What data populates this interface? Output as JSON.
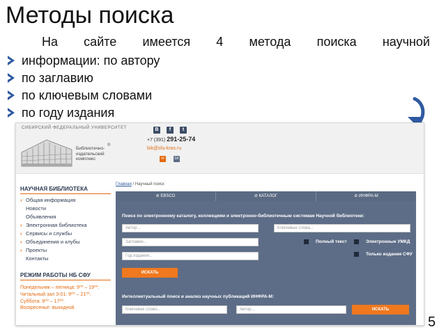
{
  "slide": {
    "title": "Методы поиска",
    "intro": "На сайте имеется 4 метода поиска научной",
    "bullets": [
      "информации: по автору",
      "по заглавию",
      "по ключевым словами",
      "по году издания"
    ],
    "page_number": "5",
    "accent_color": "#2f5aa0"
  },
  "site": {
    "university": "СИБИРСКИЙ ФЕДЕРАЛЬНЫЙ УНИВЕРСИТЕТ",
    "publisher": [
      "Библиотечно-",
      "издательский",
      "комплекс"
    ],
    "registered": "®",
    "social": [
      "В",
      "f",
      "t"
    ],
    "phone_prefix": "+7 (391)",
    "phone_number": "291-25-74",
    "email": "bik@sfu-kras.ru",
    "mini_icons": [
      "✉",
      "SK"
    ],
    "breadcrumb_home": "Главная",
    "breadcrumb_sep": "/",
    "breadcrumb_current": "Научный поиск",
    "tabs": [
      "⊘ EBSCO",
      "⊘ КАТАЛОГ",
      "⊘ ИНФРА-М"
    ],
    "sidebar": {
      "section1": "НАУЧНАЯ БИБЛИОТЕКА",
      "items": [
        {
          "arrow": "›",
          "label": "Общая информация"
        },
        {
          "arrow": "",
          "label": "Новости"
        },
        {
          "arrow": "",
          "label": "Объявления"
        },
        {
          "arrow": "›",
          "label": "Электронная библиотека"
        },
        {
          "arrow": "›",
          "label": "Сервисы и службы"
        },
        {
          "arrow": "›",
          "label": "Объединения и клубы"
        },
        {
          "arrow": "›",
          "label": "Проекты"
        },
        {
          "arrow": "",
          "label": "Контакты"
        }
      ],
      "section2": "РЕЖИМ РАБОТЫ НБ СФУ",
      "hours": [
        "Понедельник – пятница: 9⁰⁰ – 19⁰⁰.",
        "Читальный зал 3-01: 9⁰⁰ – 21⁰⁰.",
        "Суббота: 9⁰⁰ – 17⁰⁰.",
        "Воскресенье: выходной."
      ]
    },
    "search": {
      "title": "Поиск по электронному каталогу, коллекциям и электронно-библиотечным системам Научной библиотеки:",
      "author_placeholder": "Автор...",
      "keywords_placeholder": "Ключевые слова...",
      "title_placeholder": "Заглавие...",
      "year_placeholder": "Год издания...",
      "checkbox_fulltext": "Полный текст",
      "checkbox_umkd": "Электронные УМКД",
      "checkbox_sfu": "Только издания СФУ",
      "search_button": "ИСКАТЬ"
    },
    "intel": {
      "title": "Интеллектуальный поиск и анализ научных публикаций ИНФРА-М:",
      "keywords_placeholder": "Ключевое слово...",
      "author_placeholder": "Автор...",
      "search_button": "ИСКАТЬ"
    }
  }
}
